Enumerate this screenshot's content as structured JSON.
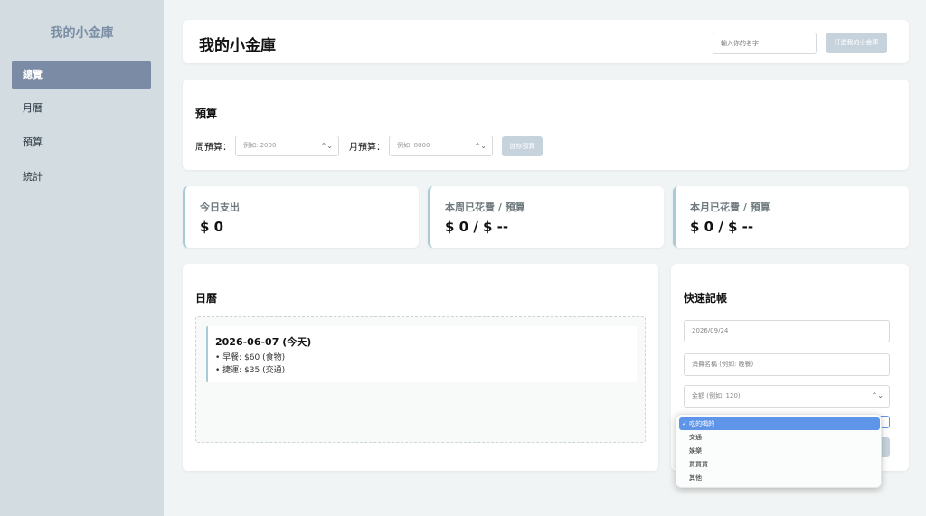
{
  "sidebar": {
    "brand": "我的小金庫",
    "items": [
      {
        "label": "總覽",
        "active": true
      },
      {
        "label": "月曆",
        "active": false
      },
      {
        "label": "預算",
        "active": false
      },
      {
        "label": "統計",
        "active": false
      }
    ]
  },
  "header": {
    "title": "我的小金庫",
    "name_placeholder": "輸入你的名字",
    "create_button": "打造我的小金庫"
  },
  "budget": {
    "title": "預算",
    "weekly_label": "周預算：",
    "weekly_placeholder": "例如: 2000",
    "monthly_label": "月預算：",
    "monthly_placeholder": "例如: 8000",
    "save_button": "儲存預算"
  },
  "stats": [
    {
      "label": "今日支出",
      "value": "$ 0"
    },
    {
      "label": "本周已花費 / 預算",
      "value": "$ 0 / $ --"
    },
    {
      "label": "本月已花費 / 預算",
      "value": "$ 0 / $ --"
    }
  ],
  "calendar": {
    "title": "日曆",
    "entry_date": "2026-06-07 (今天)",
    "entries": [
      "• 早餐: $60 (食物)",
      "• 捷運: $35 (交通)"
    ]
  },
  "quick": {
    "title": "快速記帳",
    "date_value": "2026/09/24",
    "name_placeholder": "消費名稱 (例如: 晚餐)",
    "amount_placeholder": "金額 (例如: 120)",
    "category_options": [
      {
        "label": "吃的喝的",
        "selected": true
      },
      {
        "label": "交通",
        "selected": false
      },
      {
        "label": "娛樂",
        "selected": false
      },
      {
        "label": "買買買",
        "selected": false
      },
      {
        "label": "其他",
        "selected": false
      }
    ],
    "check_mark": "✓",
    "spinner_glyph": "⌃⌄"
  },
  "colors": {
    "sidebar_bg": "#d3dde1",
    "active_nav": "#7b8ba5",
    "accent_border": "#a8cbd8",
    "disabled_button": "#c6d2dc",
    "selected_option": "#5e95e8"
  }
}
